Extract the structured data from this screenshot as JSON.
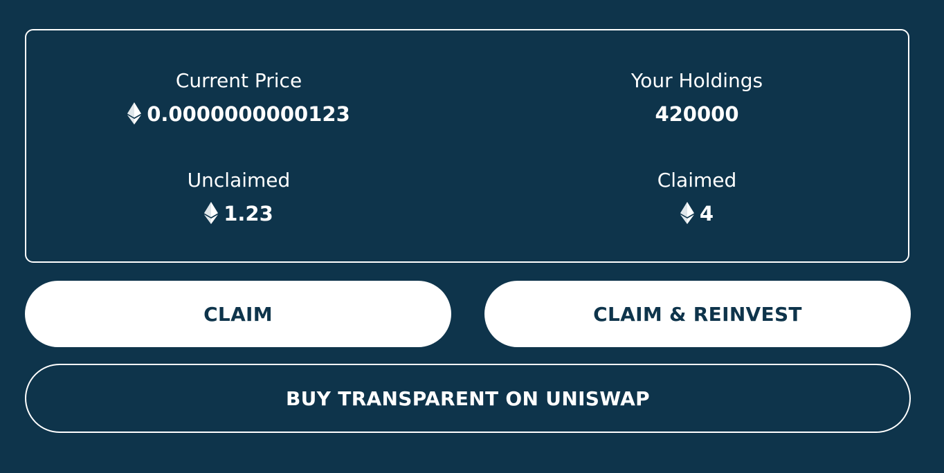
{
  "stats": {
    "current_price": {
      "label": "Current Price",
      "value": "0.0000000000123",
      "icon": "ethereum-icon"
    },
    "holdings": {
      "label": "Your Holdings",
      "value": "420000"
    },
    "unclaimed": {
      "label": "Unclaimed",
      "value": "1.23",
      "icon": "ethereum-icon"
    },
    "claimed": {
      "label": "Claimed",
      "value": "4",
      "icon": "ethereum-icon"
    }
  },
  "actions": {
    "claim_label": "CLAIM",
    "reinvest_label": "CLAIM & REINVEST",
    "buy_label": "BUY TRANSPARENT ON UNISWAP"
  },
  "colors": {
    "background": "#0e344b",
    "foreground": "#ffffff"
  }
}
